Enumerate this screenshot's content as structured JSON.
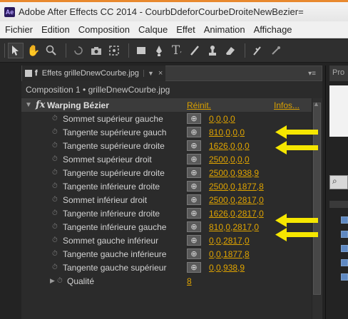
{
  "window": {
    "logo": "Ae",
    "title": "Adobe After Effects CC 2014 - CourbDdeforCourbeDroiteNewBezier="
  },
  "menu": [
    "Fichier",
    "Edition",
    "Composition",
    "Calque",
    "Effet",
    "Animation",
    "Affichage"
  ],
  "toolbar": {
    "tools": [
      "selection-tool-icon",
      "hand-tool-icon",
      "zoom-tool-icon",
      "rotate-tool-icon",
      "camera-tool-icon",
      "pan-behind-tool-icon",
      "rectangle-tool-icon",
      "pen-tool-icon",
      "text-tool-icon",
      "brush-tool-icon",
      "clone-stamp-tool-icon",
      "eraser-tool-icon",
      "roto-brush-tool-icon",
      "puppet-tool-icon"
    ]
  },
  "panel": {
    "tab_label": "Effets grilleDnewCourbe.jpg",
    "composition_label": "Composition 1 • grilleDnewCourbe.jpg"
  },
  "effect": {
    "name": "Warping Bézier",
    "reset_label": "Réinit.",
    "about_label": "Infos..."
  },
  "params": [
    {
      "name": "Sommet supérieur gauche",
      "value": "0,0,0,0"
    },
    {
      "name": "Tangente supérieure gauch",
      "value": "810,0,0,0"
    },
    {
      "name": "Tangente supérieure droite",
      "value": "1626,0,0,0"
    },
    {
      "name": "Sommet supérieur droit",
      "value": "2500,0,0,0"
    },
    {
      "name": "Tangente supérieure droite",
      "value": "2500,0,938,9"
    },
    {
      "name": "Tangente inférieure droite",
      "value": "2500,0,1877,8"
    },
    {
      "name": "Sommet inférieur droit",
      "value": "2500,0,2817,0"
    },
    {
      "name": "Tangente inférieure droite",
      "value": "1626,0,2817,0"
    },
    {
      "name": "Tangente inférieure gauche",
      "value": "810,0,2817,0"
    },
    {
      "name": "Sommet gauche inférieur",
      "value": "0,0,2817,0"
    },
    {
      "name": "Tangente gauche inférieure",
      "value": "0,0,1877,8"
    },
    {
      "name": "Tangente gauche supérieur",
      "value": "0,0,938,9"
    }
  ],
  "quality": {
    "name": "Qualité",
    "value": "8"
  },
  "right_panel": {
    "tab_label": "Pro",
    "search_icon": "search-icon"
  },
  "colors": {
    "accent": "#e0a400",
    "arrow": "#f5e600",
    "titlebar_border": "#e8892f"
  }
}
